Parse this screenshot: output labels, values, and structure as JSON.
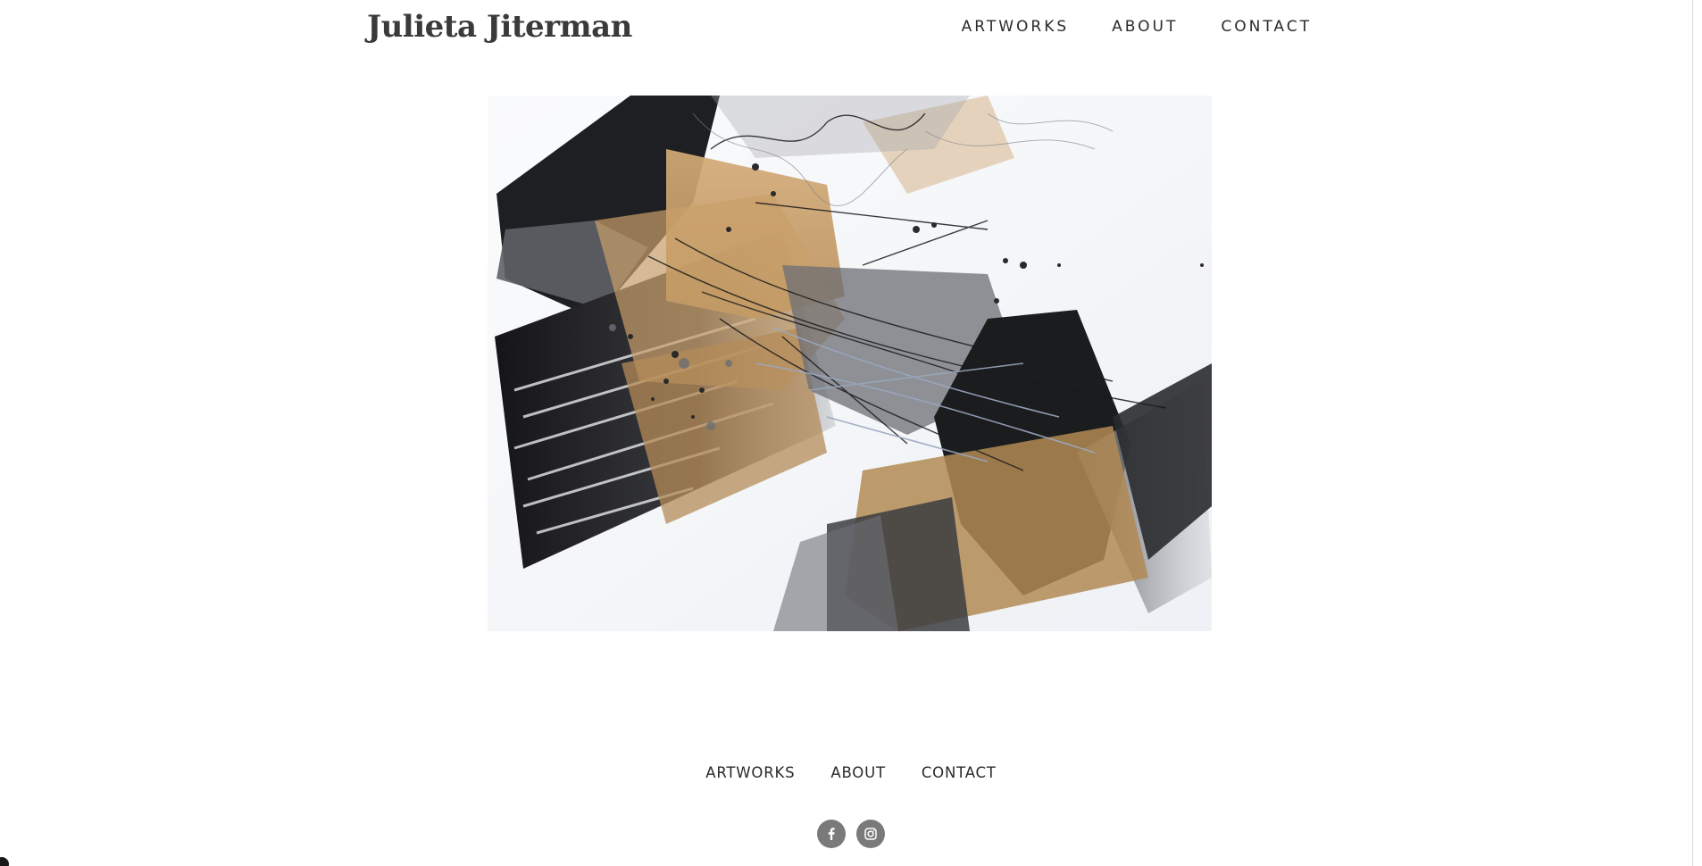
{
  "site": {
    "title": "Julieta Jiterman"
  },
  "header": {
    "nav": [
      {
        "label": "ARTWORKS"
      },
      {
        "label": "ABOUT"
      },
      {
        "label": "CONTACT"
      }
    ]
  },
  "footer": {
    "nav": [
      {
        "label": "ARTWORKS"
      },
      {
        "label": "ABOUT"
      },
      {
        "label": "CONTACT"
      }
    ],
    "social": [
      {
        "icon": "facebook-icon"
      },
      {
        "icon": "instagram-icon"
      }
    ]
  },
  "colors": {
    "text": "#2a2a2a",
    "title": "#3a3a3a",
    "social_bg": "#7a7a7a",
    "paint_ochre": "#c9a06a",
    "paint_black": "#1b1b1d",
    "paint_gray": "#8c8f96"
  }
}
